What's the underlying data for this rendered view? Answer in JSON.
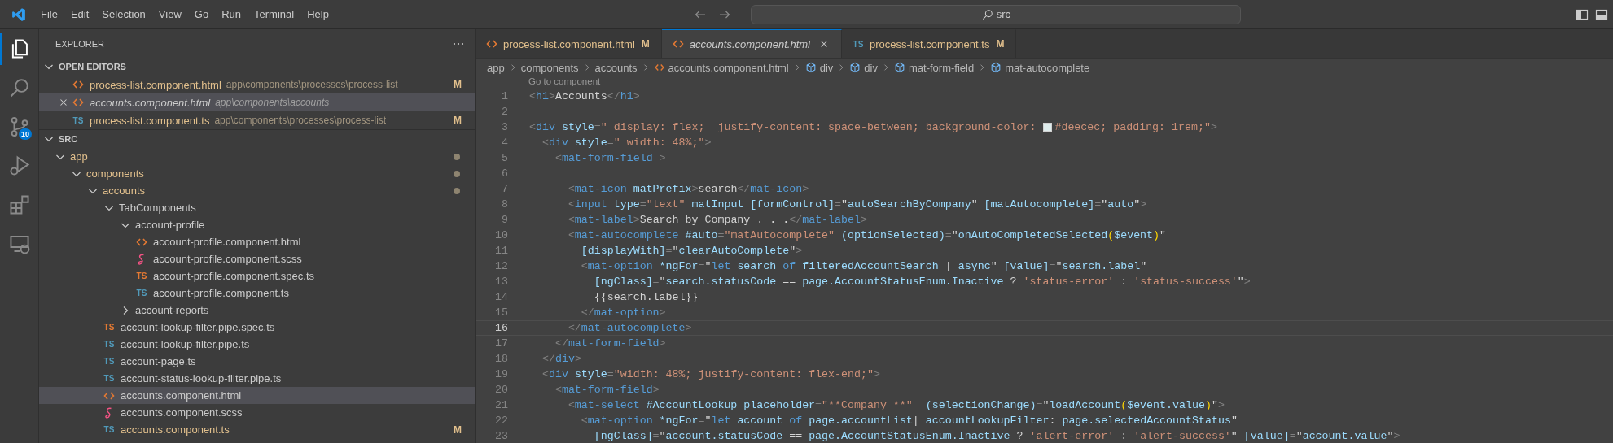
{
  "title_bar": {
    "menu": [
      "File",
      "Edit",
      "Selection",
      "View",
      "Go",
      "Run",
      "Terminal",
      "Help"
    ],
    "search": {
      "value": "src"
    }
  },
  "activity_bar": [
    {
      "kind": "explorer",
      "selected": true
    },
    {
      "kind": "search",
      "selected": false
    },
    {
      "kind": "source-control",
      "selected": false,
      "badge": "10"
    },
    {
      "kind": "run-debug",
      "selected": false
    },
    {
      "kind": "extensions",
      "selected": false
    },
    {
      "kind": "remote",
      "selected": false
    }
  ],
  "sidebar": {
    "title": "EXPLORER",
    "open_editors": {
      "title": "OPEN EDITORS",
      "expanded": true,
      "items": [
        {
          "label": "process-list.component.html",
          "path": "app\\components\\processes\\process-list",
          "kind": "html",
          "badge": "M",
          "modified": true,
          "selected": false,
          "preview": false
        },
        {
          "label": "accounts.component.html",
          "path": "app\\components\\accounts",
          "kind": "html",
          "modified": false,
          "selected": true,
          "preview": true
        },
        {
          "label": "process-list.component.ts",
          "path": "app\\components\\processes\\process-list",
          "kind": "ts",
          "icon_label": "TS",
          "badge": "M",
          "modified": true,
          "selected": false,
          "preview": false
        }
      ]
    },
    "folder": {
      "title": "SRC",
      "expanded": true,
      "tree": [
        {
          "label": "app",
          "kind": "folder",
          "expanded": true,
          "modified": true,
          "selected": false,
          "children": [
            {
              "label": "components",
              "kind": "folder",
              "expanded": true,
              "modified": true,
              "selected": false,
              "children": [
                {
                  "label": "accounts",
                  "kind": "folder",
                  "expanded": true,
                  "modified": true,
                  "selected": false,
                  "children": [
                    {
                      "label": "TabComponents",
                      "kind": "folder",
                      "expanded": true,
                      "modified": false,
                      "selected": false,
                      "children": [
                        {
                          "label": "account-profile",
                          "kind": "folder",
                          "expanded": true,
                          "modified": false,
                          "selected": false,
                          "children": [
                            {
                              "label": "account-profile.component.html",
                              "kind": "html",
                              "modified": false,
                              "selected": false
                            },
                            {
                              "label": "account-profile.component.scss",
                              "kind": "scss",
                              "modified": false,
                              "selected": false
                            },
                            {
                              "label": "account-profile.component.spec.ts",
                              "kind": "spec",
                              "icon_label": "TS",
                              "modified": false,
                              "selected": false
                            },
                            {
                              "label": "account-profile.component.ts",
                              "kind": "ts",
                              "icon_label": "TS",
                              "modified": false,
                              "selected": false
                            }
                          ]
                        },
                        {
                          "label": "account-reports",
                          "kind": "folder",
                          "expanded": false,
                          "modified": false,
                          "selected": false
                        }
                      ]
                    },
                    {
                      "label": "account-lookup-filter.pipe.spec.ts",
                      "kind": "spec",
                      "icon_label": "TS",
                      "modified": false,
                      "selected": false
                    },
                    {
                      "label": "account-lookup-filter.pipe.ts",
                      "kind": "ts",
                      "icon_label": "TS",
                      "modified": false,
                      "selected": false
                    },
                    {
                      "label": "account-page.ts",
                      "kind": "ts",
                      "icon_label": "TS",
                      "modified": false,
                      "selected": false
                    },
                    {
                      "label": "account-status-lookup-filter.pipe.ts",
                      "kind": "ts",
                      "icon_label": "TS",
                      "modified": false,
                      "selected": false
                    },
                    {
                      "label": "accounts.component.html",
                      "kind": "html",
                      "modified": false,
                      "selected": true
                    },
                    {
                      "label": "accounts.component.scss",
                      "kind": "scss",
                      "modified": false,
                      "selected": false
                    },
                    {
                      "label": "accounts.component.ts",
                      "kind": "ts",
                      "icon_label": "TS",
                      "badge": "M",
                      "modified": true,
                      "selected": false
                    }
                  ]
                }
              ]
            }
          ]
        }
      ]
    }
  },
  "editor": {
    "tabs": [
      {
        "label": "process-list.component.html",
        "kind": "html",
        "badge": "M",
        "modified": true,
        "selected": false,
        "preview": false
      },
      {
        "label": "accounts.component.html",
        "kind": "html",
        "modified": false,
        "selected": true,
        "preview": true
      },
      {
        "label": "process-list.component.ts",
        "kind": "ts",
        "icon_label": "TS",
        "badge": "M",
        "modified": true,
        "selected": false,
        "preview": false
      }
    ],
    "breadcrumb": [
      {
        "label": "app",
        "kind": "folder"
      },
      {
        "label": "components",
        "kind": "folder"
      },
      {
        "label": "accounts",
        "kind": "folder"
      },
      {
        "label": "accounts.component.html",
        "kind": "html"
      },
      {
        "label": "div",
        "kind": "element"
      },
      {
        "label": "div",
        "kind": "element"
      },
      {
        "label": "mat-form-field",
        "kind": "element"
      },
      {
        "label": "mat-autocomplete",
        "kind": "element"
      }
    ],
    "code_lens": "Go to component",
    "lines": [
      {
        "number": "1",
        "current": false,
        "tokens": [
          {
            "kind": "punct",
            "text": "<"
          },
          {
            "kind": "tag",
            "text": "h1"
          },
          {
            "kind": "punct",
            "text": ">"
          },
          {
            "kind": "text",
            "text": "Accounts"
          },
          {
            "kind": "punct",
            "text": "</"
          },
          {
            "kind": "tag",
            "text": "h1"
          },
          {
            "kind": "punct",
            "text": ">"
          }
        ]
      },
      {
        "number": "2",
        "current": false
      },
      {
        "number": "3",
        "current": false,
        "tokens": [
          {
            "kind": "punct",
            "text": "<"
          },
          {
            "kind": "tag",
            "text": "div"
          },
          {
            "kind": "attr",
            "text": " style"
          },
          {
            "kind": "punct",
            "text": "="
          },
          {
            "kind": "string",
            "text": "\" display: flex;  justify-content: space-between; background-color: "
          },
          {
            "kind": "swatch",
            "color": "#deecec"
          },
          {
            "kind": "string",
            "text": "#deecec; padding: 1rem;\""
          },
          {
            "kind": "punct",
            "text": ">"
          }
        ]
      },
      {
        "number": "4",
        "current": false,
        "tokens": [
          {
            "kind": "punct",
            "text": "  <"
          },
          {
            "kind": "tag",
            "text": "div"
          },
          {
            "kind": "attr",
            "text": " style"
          },
          {
            "kind": "punct",
            "text": "="
          },
          {
            "kind": "string",
            "text": "\" width: 48%;\""
          },
          {
            "kind": "punct",
            "text": ">"
          }
        ]
      },
      {
        "number": "5",
        "current": false,
        "tokens": [
          {
            "kind": "punct",
            "text": "    <"
          },
          {
            "kind": "tag",
            "text": "mat-form-field"
          },
          {
            "kind": "punct",
            "text": " >"
          }
        ]
      },
      {
        "number": "6",
        "current": false
      },
      {
        "number": "7",
        "current": false,
        "tokens": [
          {
            "kind": "punct",
            "text": "      <"
          },
          {
            "kind": "tag",
            "text": "mat-icon"
          },
          {
            "kind": "attr",
            "text": " matPrefix"
          },
          {
            "kind": "punct",
            "text": ">"
          },
          {
            "kind": "text",
            "text": "search"
          },
          {
            "kind": "punct",
            "text": "</"
          },
          {
            "kind": "tag",
            "text": "mat-icon"
          },
          {
            "kind": "punct",
            "text": ">"
          }
        ]
      },
      {
        "number": "8",
        "current": false,
        "tokens": [
          {
            "kind": "punct",
            "text": "      <"
          },
          {
            "kind": "tag",
            "text": "input"
          },
          {
            "kind": "attr",
            "text": " type"
          },
          {
            "kind": "punct",
            "text": "="
          },
          {
            "kind": "string",
            "text": "\"text\""
          },
          {
            "kind": "attr",
            "text": " matInput [formControl]"
          },
          {
            "kind": "punct",
            "text": "="
          },
          {
            "kind": "text",
            "text": "\""
          },
          {
            "kind": "var",
            "text": "autoSearchByCompany"
          },
          {
            "kind": "text",
            "text": "\""
          },
          {
            "kind": "attr",
            "text": " [matAutocomplete]"
          },
          {
            "kind": "punct",
            "text": "="
          },
          {
            "kind": "text",
            "text": "\""
          },
          {
            "kind": "var",
            "text": "auto"
          },
          {
            "kind": "text",
            "text": "\""
          },
          {
            "kind": "punct",
            "text": ">"
          }
        ]
      },
      {
        "number": "9",
        "current": false,
        "tokens": [
          {
            "kind": "punct",
            "text": "      <"
          },
          {
            "kind": "tag",
            "text": "mat-label"
          },
          {
            "kind": "punct",
            "text": ">"
          },
          {
            "kind": "text",
            "text": "Search by Company . . ."
          },
          {
            "kind": "punct",
            "text": "</"
          },
          {
            "kind": "tag",
            "text": "mat-label"
          },
          {
            "kind": "punct",
            "text": ">"
          }
        ]
      },
      {
        "number": "10",
        "current": false,
        "tokens": [
          {
            "kind": "punct",
            "text": "      <"
          },
          {
            "kind": "tag",
            "text": "mat-autocomplete"
          },
          {
            "kind": "attr",
            "text": " #auto"
          },
          {
            "kind": "punct",
            "text": "="
          },
          {
            "kind": "string",
            "text": "\"matAutocomplete\""
          },
          {
            "kind": "attr",
            "text": " (optionSelected)"
          },
          {
            "kind": "punct",
            "text": "="
          },
          {
            "kind": "text",
            "text": "\""
          },
          {
            "kind": "var",
            "text": "onAutoCompletedSelected"
          },
          {
            "kind": "bracket",
            "text": "("
          },
          {
            "kind": "var",
            "text": "$event"
          },
          {
            "kind": "bracket",
            "text": ")"
          },
          {
            "kind": "text",
            "text": "\""
          }
        ]
      },
      {
        "number": "11",
        "current": false,
        "tokens": [
          {
            "kind": "attr",
            "text": "        [displayWith]"
          },
          {
            "kind": "punct",
            "text": "="
          },
          {
            "kind": "text",
            "text": "\""
          },
          {
            "kind": "var",
            "text": "clearAutoComplete"
          },
          {
            "kind": "text",
            "text": "\""
          },
          {
            "kind": "punct",
            "text": ">"
          }
        ]
      },
      {
        "number": "12",
        "current": false,
        "tokens": [
          {
            "kind": "punct",
            "text": "        <"
          },
          {
            "kind": "tag",
            "text": "mat-option"
          },
          {
            "kind": "attr",
            "text": " *ngFor"
          },
          {
            "kind": "punct",
            "text": "="
          },
          {
            "kind": "text",
            "text": "\""
          },
          {
            "kind": "keyword",
            "text": "let"
          },
          {
            "kind": "var",
            "text": " search"
          },
          {
            "kind": "keyword",
            "text": " of"
          },
          {
            "kind": "var",
            "text": " filteredAccountSearch"
          },
          {
            "kind": "text",
            "text": " | "
          },
          {
            "kind": "var",
            "text": "async"
          },
          {
            "kind": "text",
            "text": "\""
          },
          {
            "kind": "attr",
            "text": " [value]"
          },
          {
            "kind": "punct",
            "text": "="
          },
          {
            "kind": "text",
            "text": "\""
          },
          {
            "kind": "var",
            "text": "search.label"
          },
          {
            "kind": "text",
            "text": "\""
          }
        ]
      },
      {
        "number": "13",
        "current": false,
        "tokens": [
          {
            "kind": "attr",
            "text": "          [ngClass]"
          },
          {
            "kind": "punct",
            "text": "="
          },
          {
            "kind": "text",
            "text": "\""
          },
          {
            "kind": "var",
            "text": "search.statusCode"
          },
          {
            "kind": "text",
            "text": " == "
          },
          {
            "kind": "var",
            "text": "page.AccountStatusEnum.Inactive"
          },
          {
            "kind": "text",
            "text": " ? "
          },
          {
            "kind": "string",
            "text": "'status-error'"
          },
          {
            "kind": "text",
            "text": " : "
          },
          {
            "kind": "string",
            "text": "'status-success'"
          },
          {
            "kind": "text",
            "text": "\""
          },
          {
            "kind": "punct",
            "text": ">"
          }
        ]
      },
      {
        "number": "14",
        "current": false,
        "tokens": [
          {
            "kind": "text",
            "text": "          {{search.label}}"
          }
        ]
      },
      {
        "number": "15",
        "current": false,
        "tokens": [
          {
            "kind": "punct",
            "text": "        </"
          },
          {
            "kind": "tag",
            "text": "mat-option"
          },
          {
            "kind": "punct",
            "text": ">"
          }
        ]
      },
      {
        "number": "16",
        "current": true,
        "tokens": [
          {
            "kind": "punct",
            "text": "      </"
          },
          {
            "kind": "tag",
            "text": "mat-autocomplete"
          },
          {
            "kind": "punct",
            "text": ">"
          }
        ]
      },
      {
        "number": "17",
        "current": false,
        "tokens": [
          {
            "kind": "punct",
            "text": "    </"
          },
          {
            "kind": "tag",
            "text": "mat-form-field"
          },
          {
            "kind": "punct",
            "text": ">"
          }
        ]
      },
      {
        "number": "18",
        "current": false,
        "tokens": [
          {
            "kind": "punct",
            "text": "  </"
          },
          {
            "kind": "tag",
            "text": "div"
          },
          {
            "kind": "punct",
            "text": ">"
          }
        ]
      },
      {
        "number": "19",
        "current": false,
        "tokens": [
          {
            "kind": "punct",
            "text": "  <"
          },
          {
            "kind": "tag",
            "text": "div"
          },
          {
            "kind": "attr",
            "text": " style"
          },
          {
            "kind": "punct",
            "text": "="
          },
          {
            "kind": "string",
            "text": "\"width: 48%; justify-content: flex-end;\""
          },
          {
            "kind": "punct",
            "text": ">"
          }
        ]
      },
      {
        "number": "20",
        "current": false,
        "tokens": [
          {
            "kind": "punct",
            "text": "    <"
          },
          {
            "kind": "tag",
            "text": "mat-form-field"
          },
          {
            "kind": "punct",
            "text": ">"
          }
        ]
      },
      {
        "number": "21",
        "current": false,
        "tokens": [
          {
            "kind": "punct",
            "text": "      <"
          },
          {
            "kind": "tag",
            "text": "mat-select"
          },
          {
            "kind": "attr",
            "text": " #AccountLookup placeholder"
          },
          {
            "kind": "punct",
            "text": "="
          },
          {
            "kind": "string",
            "text": "\"**Company **\""
          },
          {
            "kind": "attr",
            "text": "  (selectionChange)"
          },
          {
            "kind": "punct",
            "text": "="
          },
          {
            "kind": "text",
            "text": "\""
          },
          {
            "kind": "var",
            "text": "loadAccount"
          },
          {
            "kind": "bracket",
            "text": "("
          },
          {
            "kind": "var",
            "text": "$event.value"
          },
          {
            "kind": "bracket",
            "text": ")"
          },
          {
            "kind": "text",
            "text": "\""
          },
          {
            "kind": "punct",
            "text": ">"
          }
        ]
      },
      {
        "number": "22",
        "current": false,
        "tokens": [
          {
            "kind": "punct",
            "text": "        <"
          },
          {
            "kind": "tag",
            "text": "mat-option"
          },
          {
            "kind": "attr",
            "text": " *ngFor"
          },
          {
            "kind": "punct",
            "text": "="
          },
          {
            "kind": "text",
            "text": "\""
          },
          {
            "kind": "keyword",
            "text": "let"
          },
          {
            "kind": "var",
            "text": " account"
          },
          {
            "kind": "keyword",
            "text": " of"
          },
          {
            "kind": "var",
            "text": " page.accountList"
          },
          {
            "kind": "text",
            "text": "| "
          },
          {
            "kind": "var",
            "text": "accountLookupFilter"
          },
          {
            "kind": "text",
            "text": ": "
          },
          {
            "kind": "var",
            "text": "page.selectedAccountStatus"
          },
          {
            "kind": "text",
            "text": "\""
          }
        ]
      },
      {
        "number": "23",
        "current": false,
        "tokens": [
          {
            "kind": "attr",
            "text": "          [ngClass]"
          },
          {
            "kind": "punct",
            "text": "="
          },
          {
            "kind": "text",
            "text": "\""
          },
          {
            "kind": "var",
            "text": "account.statusCode"
          },
          {
            "kind": "text",
            "text": " == "
          },
          {
            "kind": "var",
            "text": "page.AccountStatusEnum.Inactive"
          },
          {
            "kind": "text",
            "text": " ? "
          },
          {
            "kind": "string",
            "text": "'alert-error'"
          },
          {
            "kind": "text",
            "text": " : "
          },
          {
            "kind": "string",
            "text": "'alert-success'"
          },
          {
            "kind": "text",
            "text": "\""
          },
          {
            "kind": "attr",
            "text": " [value]"
          },
          {
            "kind": "punct",
            "text": "="
          },
          {
            "kind": "text",
            "text": "\""
          },
          {
            "kind": "var",
            "text": "account.value"
          },
          {
            "kind": "text",
            "text": "\""
          },
          {
            "kind": "punct",
            "text": ">"
          }
        ]
      }
    ]
  }
}
